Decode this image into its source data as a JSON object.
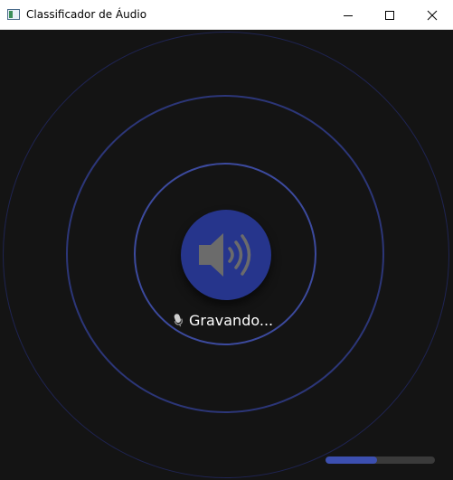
{
  "window": {
    "title": "Classificador de Áudio",
    "app_icon": "window-app-icon",
    "controls": {
      "minimize_icon": "minimize-icon",
      "maximize_icon": "maximize-icon",
      "close_icon": "close-icon"
    }
  },
  "main": {
    "speaker_icon": "speaker-volume-icon",
    "status": {
      "icon": "microphone-icon",
      "text": "Gravando..."
    },
    "progress": {
      "value": 0.47
    }
  },
  "colors": {
    "background": "#141414",
    "accent": "#26358c",
    "ring_inner": "#3c4a9e",
    "ring_middle": "#2c3678",
    "ring_outer": "#1f2452",
    "speaker_glyph": "#6b6b6b",
    "progress_fill": "#3c4fb0",
    "progress_track": "#3a3a3a"
  }
}
